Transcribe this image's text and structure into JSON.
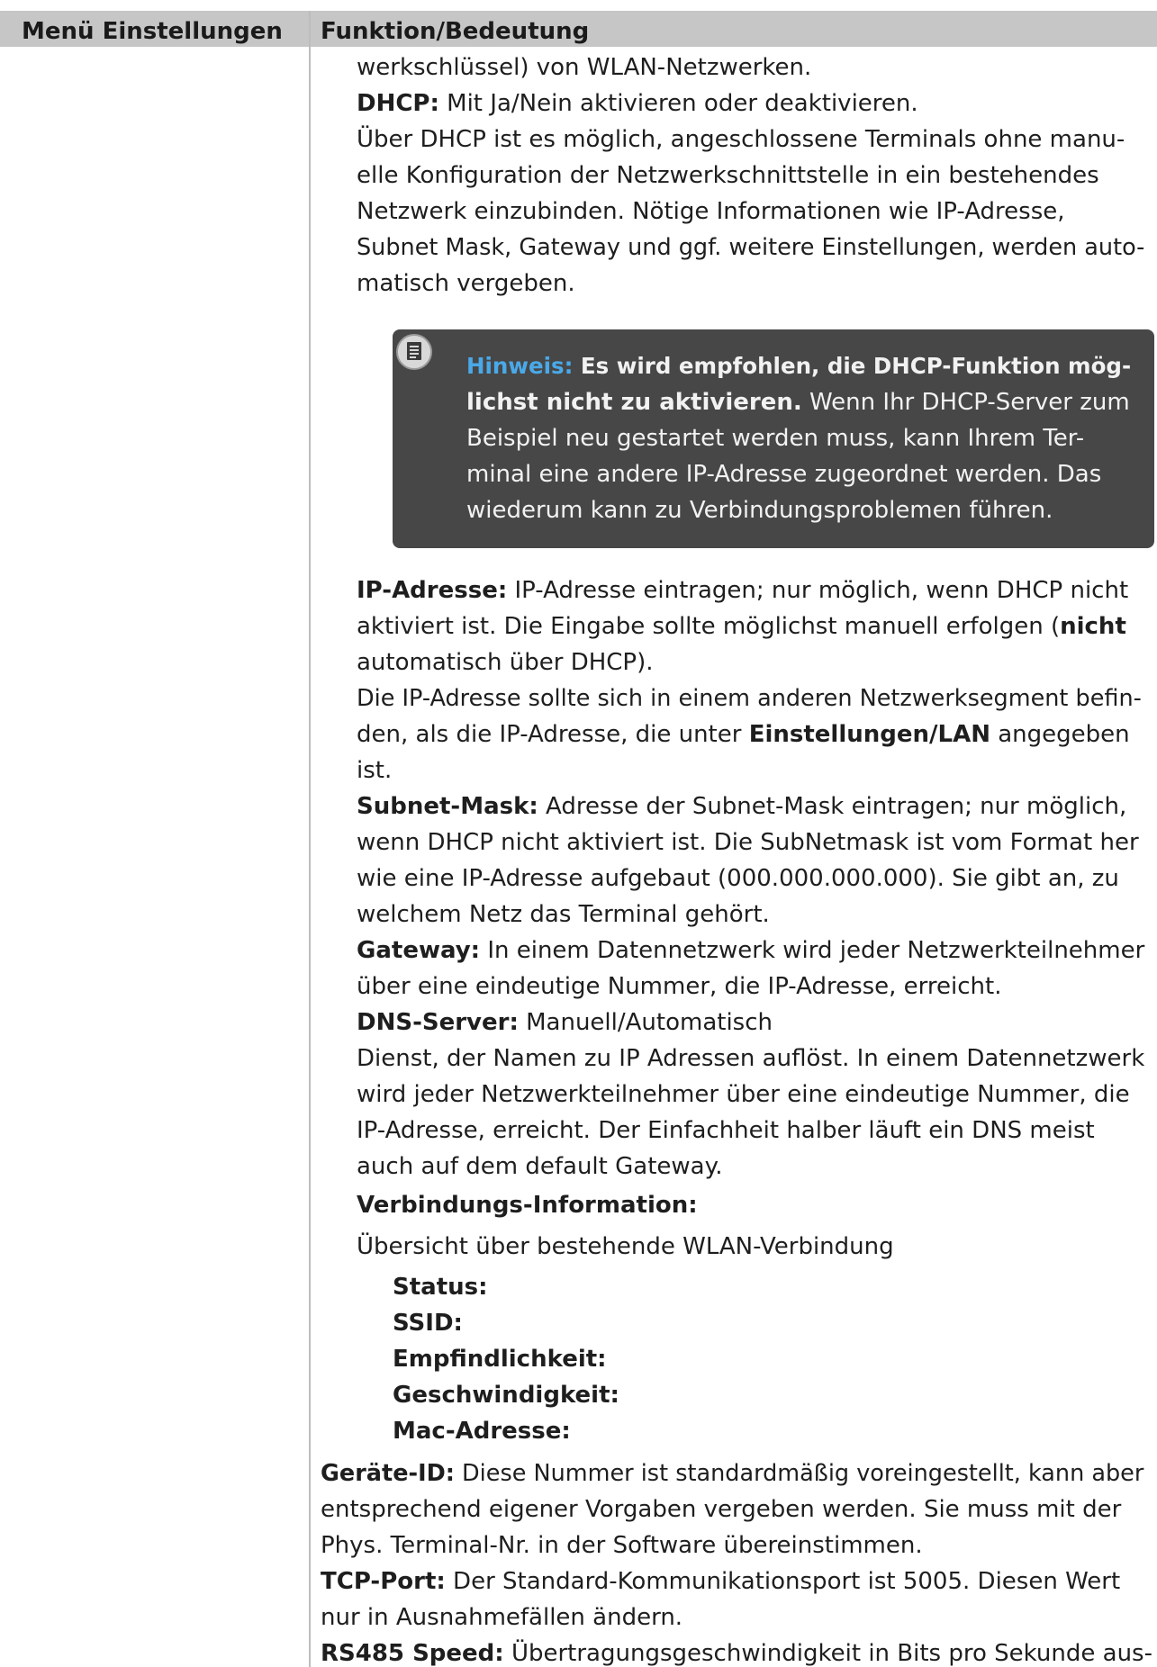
{
  "header": {
    "col1": "Menü Einstellungen",
    "col2": "Funktion/Bedeutung"
  },
  "text": {
    "l01": "werkschlüssel) von WLAN-Netzwerken.",
    "l02_b": "DHCP:",
    "l02": " Mit Ja/Nein aktivieren oder deaktivieren.",
    "l03": "Über DHCP ist es möglich, angeschlossene Terminals ohne manu-",
    "l04": "elle Konfiguration der Netzwerkschnittstelle in ein bestehendes",
    "l05": "Netzwerk einzubinden. Nötige Informationen wie IP-Adresse,",
    "l06": "Subnet Mask, Gateway und ggf. weitere Einstellungen, werden auto-",
    "l07": "matisch vergeben.",
    "l08_b": "IP-Adresse:",
    "l08": " IP-Adresse eintragen; nur möglich, wenn DHCP nicht",
    "l09a": "aktiviert ist. Die Eingabe sollte möglichst manuell erfolgen (",
    "l09_b": "nicht",
    "l10": "automatisch über DHCP).",
    "l11": "Die IP-Adresse sollte sich in einem anderen Netzwerksegment befin-",
    "l12a": "den, als die IP-Adresse, die unter ",
    "l12_b": "Einstellungen/LAN",
    "l12c": " angegeben",
    "l13": "ist.",
    "l14_b": "Subnet-Mask:",
    "l14": " Adresse der Subnet-Mask eintragen; nur möglich,",
    "l15": "wenn DHCP nicht aktiviert ist. Die SubNetmask ist vom Format her",
    "l16": "wie eine IP-Adresse aufgebaut (000.000.000.000). Sie gibt an, zu",
    "l17": "welchem Netz das Terminal gehört.",
    "l18_b": "Gateway:",
    "l18": " In einem Datennetzwerk wird jeder Netzwerkteilnehmer",
    "l19": "über eine eindeutige Nummer, die IP-Adresse, erreicht.",
    "l20_b": "DNS-Server:",
    "l20": " Manuell/Automatisch",
    "l21": "Dienst, der Namen zu IP Adressen auflöst. In einem Datennetzwerk",
    "l22": "wird jeder Netzwerkteilnehmer über eine eindeutige Nummer, die",
    "l23": "IP-Adresse, erreicht. Der Einfachheit halber läuft ein DNS meist",
    "l24": "auch auf dem default Gateway.",
    "l25_b": "Verbindungs-Information:",
    "l26": "Übersicht über bestehende WLAN-Verbindung",
    "s1": "Status:",
    "s2": "SSID:",
    "s3": "Empfindlichkeit:",
    "s4": "Geschwindigkeit:",
    "s5": "Mac-Adresse:",
    "g1_b": "Geräte-ID:",
    "g1": " Diese Nummer ist standardmäßig voreingestellt, kann aber",
    "g2": "entsprechend eigener Vorgaben vergeben werden. Sie muss mit der",
    "g3": "Phys. Terminal-Nr. in der Software übereinstimmen.",
    "t1_b": "TCP-Port:",
    "t1": " Der Standard-Kommunikationsport ist 5005. Diesen Wert",
    "t2": "nur in Ausnahmefällen ändern.",
    "r1_b": "RS485 Speed:",
    "r1": " Übertragungsgeschwindigkeit in Bits pro Sekunde aus-"
  },
  "note": {
    "label": "Hinweis:",
    "bold1": " Es wird empfohlen, die DHCP-Funktion mög-",
    "bold2": "lichst nicht zu aktivieren.",
    "rest2": " Wenn Ihr DHCP-Server zum",
    "l3": "Beispiel neu gestartet werden muss, kann Ihrem Ter-",
    "l4": "minal eine andere IP-Adresse zugeordnet werden. Das",
    "l5": "wiederum kann zu Verbindungsproblemen führen.",
    "icon": "document-icon"
  },
  "colors": {
    "header_bg": "#c6c6c6",
    "note_bg": "#474747",
    "hint_label": "#4aa9e8"
  }
}
